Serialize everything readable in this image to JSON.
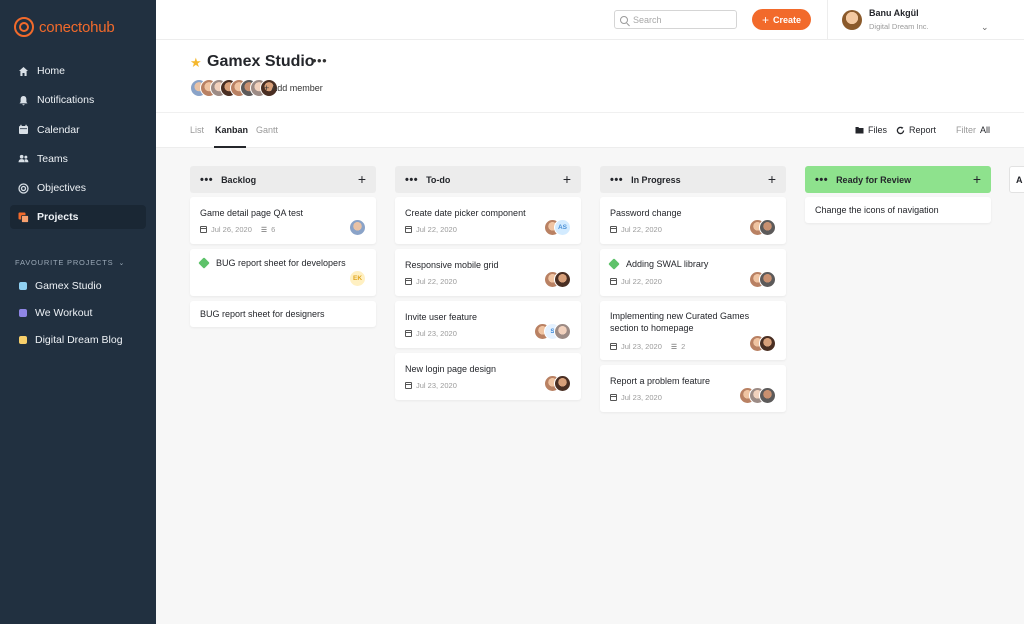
{
  "app": {
    "logo_text": "conectohub",
    "brand_color": "#f26a2b",
    "sidebar_color": "#213040"
  },
  "sidebar": {
    "nav": [
      {
        "label": "Home",
        "icon": "home-icon"
      },
      {
        "label": "Notifications",
        "icon": "bell-icon"
      },
      {
        "label": "Calendar",
        "icon": "calendar-icon"
      },
      {
        "label": "Teams",
        "icon": "users-icon"
      },
      {
        "label": "Objectives",
        "icon": "target-icon"
      },
      {
        "label": "Projects",
        "icon": "projects-icon",
        "active": true
      }
    ],
    "favourites_title": "FAVOURITE PROJECTS",
    "favourites": [
      {
        "label": "Gamex Studio",
        "color": "#8fd0f2"
      },
      {
        "label": "We Workout",
        "color": "#8f86e6"
      },
      {
        "label": "Digital Dream Blog",
        "color": "#f7cf6a"
      }
    ]
  },
  "topbar": {
    "search_placeholder": "Search",
    "create_label": "Create",
    "user_name": "Banu Akgül",
    "user_org": "Digital Dream Inc."
  },
  "project": {
    "title": "Gamex Studio",
    "add_member_label": "Add member"
  },
  "tabs": [
    "List",
    "Kanban",
    "Gantt"
  ],
  "toolbar": {
    "files_label": "Files",
    "report_label": "Report",
    "filter_label": "Filter",
    "filter_value": "All"
  },
  "board": {
    "columns": [
      {
        "title": "Backlog",
        "cards": [
          {
            "title": "Game detail page QA test",
            "date": "Jul 26, 2020",
            "subtasks": "6"
          },
          {
            "title": "BUG report sheet for developers",
            "tag": "EK"
          },
          {
            "title": "BUG report sheet for designers"
          }
        ]
      },
      {
        "title": "To-do",
        "cards": [
          {
            "title": "Create date picker component",
            "date": "Jul 22, 2020",
            "tag": "AS"
          },
          {
            "title": "Responsive mobile grid",
            "date": "Jul 22, 2020"
          },
          {
            "title": "Invite user feature",
            "date": "Jul 23, 2020",
            "tag": "S"
          },
          {
            "title": "New login page design",
            "date": "Jul 23, 2020"
          }
        ]
      },
      {
        "title": "In Progress",
        "cards": [
          {
            "title": "Password change",
            "date": "Jul 22, 2020"
          },
          {
            "title": "Adding SWAL library",
            "date": "Jul 22, 2020"
          },
          {
            "title": "Implementing new Curated Games section to homepage",
            "date": "Jul 23, 2020",
            "subtasks": "2"
          },
          {
            "title": "Report a problem feature",
            "date": "Jul 23, 2020"
          }
        ]
      },
      {
        "title": "Ready for Review",
        "cards": [
          {
            "title": "Change the icons of navigation"
          }
        ]
      }
    ],
    "next_column_peek": "A"
  }
}
